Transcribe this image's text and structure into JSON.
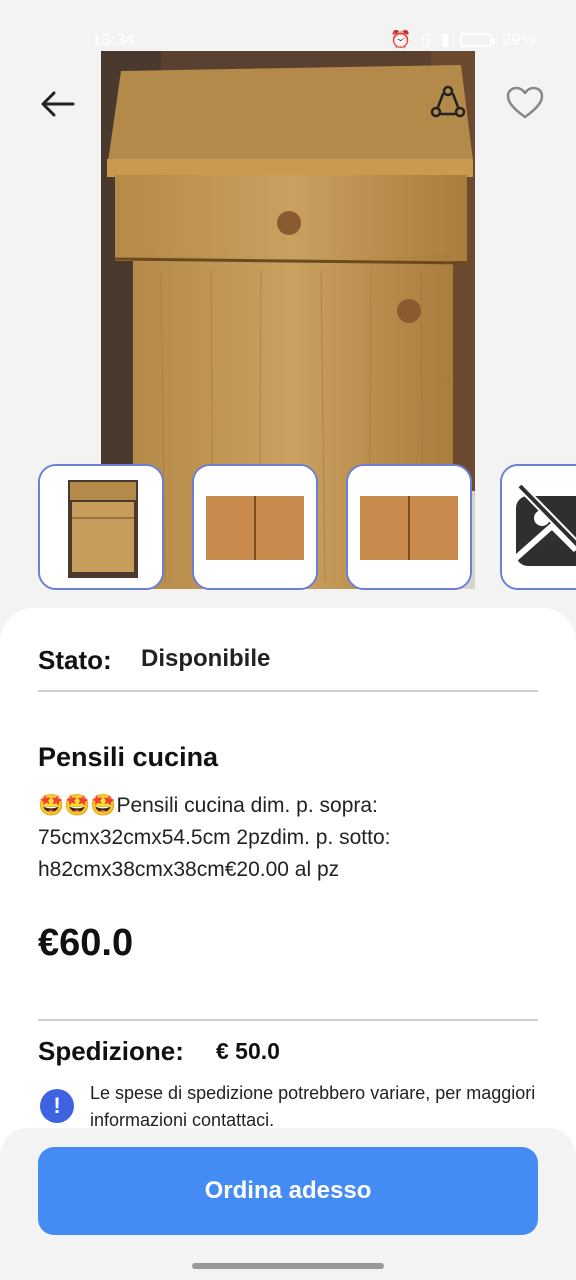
{
  "status_bar": {
    "time": "13:34",
    "battery": "29%"
  },
  "icons": {
    "back": "arrow-left-icon",
    "share": "share-icon",
    "favorite": "heart-icon",
    "info": "info-icon"
  },
  "hero": {
    "image": "wooden-kitchen-cabinet-photo"
  },
  "thumbnails": [
    {
      "image": "cabinet-front-photo"
    },
    {
      "image": "cabinet-doors-photo"
    },
    {
      "image": "cabinet-doors-photo-2"
    },
    {
      "image": "broken-image-icon"
    }
  ],
  "details": {
    "status_label": "Stato:",
    "status_value": "Disponibile",
    "title": "Pensili cucina",
    "description": "🤩🤩🤩Pensili cucina dim. p. sopra:\n75cmx32cmx54.5cm  2pzdim. p. sotto:\nh82cmx38cmx38cm€20.00 al pz",
    "price": "€60.0",
    "shipping_label": "Spedizione:",
    "shipping_value": "€ 50.0",
    "info_mark": "!",
    "shipping_note": "Le spese di spedizione potrebbero variare, per maggiori informazioni contattaci."
  },
  "actions": {
    "order_label": "Ordina adesso"
  },
  "colors": {
    "accent": "#448cf4",
    "info": "#3d63e0",
    "thumb_border": "#6a7fd6"
  }
}
